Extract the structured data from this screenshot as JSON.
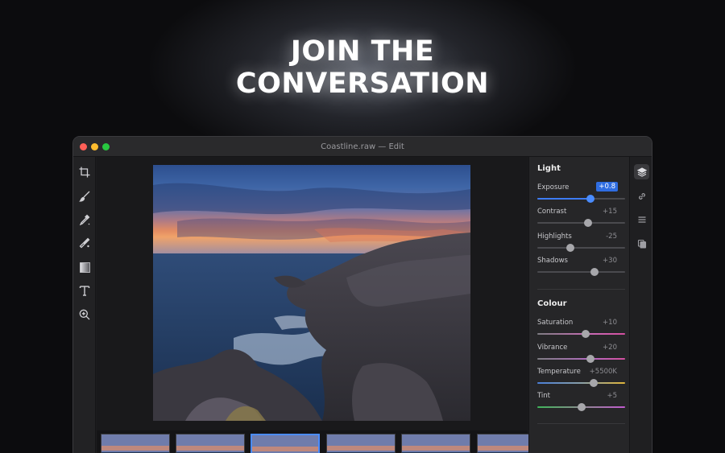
{
  "headline": {
    "line1": "JOIN THE",
    "line2": "CONVERSATION"
  },
  "window": {
    "title": "Coastline.raw — Edit"
  },
  "tools": [
    "crop-icon",
    "brush-icon",
    "dropper-icon",
    "healing-icon",
    "gradient-icon",
    "text-icon",
    "zoom-icon"
  ],
  "panel": {
    "light": {
      "title": "Light",
      "sliders": [
        {
          "label": "Exposure",
          "value": "+0.8",
          "level": 0.61
        },
        {
          "label": "Contrast",
          "value": "+15",
          "level": 0.58
        },
        {
          "label": "Highlights",
          "value": "-25",
          "level": 0.375
        },
        {
          "label": "Shadows",
          "value": "+30",
          "level": 0.65
        }
      ]
    },
    "colour": {
      "title": "Colour",
      "sliders": [
        {
          "label": "Saturation",
          "value": "+10",
          "level": 0.55
        },
        {
          "label": "Vibrance",
          "value": "+20",
          "level": 0.61
        },
        {
          "label": "Temperature",
          "value": "+5500K",
          "level": 0.64
        },
        {
          "label": "Tint",
          "value": "+5",
          "level": 0.5
        }
      ]
    }
  },
  "side_icons": [
    "layers-icon",
    "link-icon",
    "list-icon",
    "copy-icon"
  ],
  "filmstrip": {
    "count": 6,
    "selected": 2
  },
  "colors": {
    "accent": "#3d7cf4",
    "background": "#0c0c0e"
  }
}
